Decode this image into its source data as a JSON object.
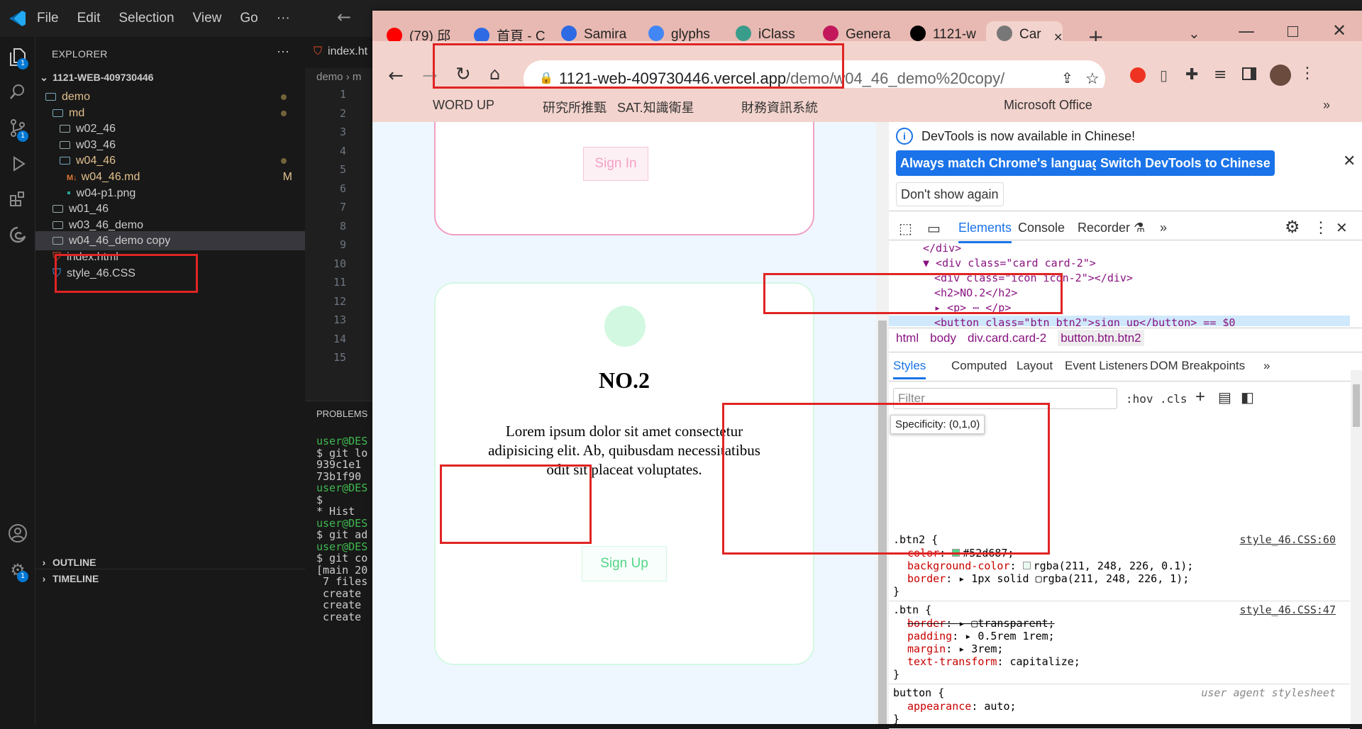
{
  "vscode": {
    "menu": [
      "File",
      "Edit",
      "Selection",
      "View",
      "Go",
      "···"
    ],
    "explorer_title": "EXPLORER",
    "explorer_more": "···",
    "project": "1121-WEB-409730446",
    "tree": [
      {
        "label": "demo",
        "indent": 1,
        "chev": "⌄",
        "type": "folder",
        "color": "#e2c08d",
        "dot": true
      },
      {
        "label": "md",
        "indent": 2,
        "chev": "⌄",
        "type": "folder",
        "color": "#e2c08d",
        "dot": true
      },
      {
        "label": "w02_46",
        "indent": 3,
        "chev": "›",
        "type": "folder",
        "color": "#ccc",
        "dot": false
      },
      {
        "label": "w03_46",
        "indent": 3,
        "chev": "›",
        "type": "folder",
        "color": "#ccc",
        "dot": false
      },
      {
        "label": "w04_46",
        "indent": 3,
        "chev": "⌄",
        "type": "folder",
        "color": "#e2c08d",
        "dot": true
      },
      {
        "label": "w04_46.md",
        "indent": 4,
        "type": "md",
        "color": "#e2c08d",
        "mark": "M"
      },
      {
        "label": "w04-p1.png",
        "indent": 4,
        "type": "img",
        "color": "#ccc"
      },
      {
        "label": "w01_46",
        "indent": 2,
        "chev": "›",
        "type": "folder",
        "color": "#ccc"
      },
      {
        "label": "w03_46_demo",
        "indent": 2,
        "chev": "›",
        "type": "folder",
        "color": "#ccc"
      },
      {
        "label": "w04_46_demo copy",
        "indent": 2,
        "chev": "›",
        "type": "folder",
        "color": "#ccc",
        "selected": true
      },
      {
        "label": "index.html",
        "indent": 2,
        "type": "html",
        "color": "#ccc"
      },
      {
        "label": "style_46.CSS",
        "indent": 2,
        "type": "css",
        "color": "#ccc"
      }
    ],
    "outline": "OUTLINE",
    "timeline": "TIMELINE",
    "editor_tab": "index.ht",
    "breadcrumb": "demo › m",
    "line_numbers": [
      "1",
      "2",
      "3",
      "4",
      "5",
      "6",
      "7",
      "8",
      "9",
      "10",
      "11",
      "12",
      "13",
      "14",
      "15"
    ],
    "panel_label": "PROBLEMS",
    "terminal": [
      "user@DES",
      "$ git lo",
      "939c1e1",
      "73b1f90",
      "",
      "user@DES",
      "$",
      "* Hist",
      "",
      "user@DES",
      "$ git ad",
      "",
      "user@DES",
      "$ git co",
      "[main 20",
      " 7 files",
      " create",
      " create",
      " create"
    ],
    "badges": {
      "explorer": "1",
      "scm": "1",
      "settings": "1"
    }
  },
  "chrome": {
    "tabs": [
      {
        "title": "(79) 邱",
        "color": "#ff0000"
      },
      {
        "title": "首頁 - C",
        "color": "#2d6ae3"
      },
      {
        "title": "Samira",
        "color": "#2d6ae3"
      },
      {
        "title": "glyphs",
        "color": "#4285f4"
      },
      {
        "title": "iClass",
        "color": "#3a9c8a"
      },
      {
        "title": "Genera",
        "color": "#c2185b"
      },
      {
        "title": "1121-w",
        "color": "#000"
      },
      {
        "title": "Car",
        "color": "#777"
      }
    ],
    "url_host": "1121-web-409730446.vercel.app",
    "url_path": "/demo/w04_46_demo%20copy/",
    "bookmarks": [
      "WORD UP",
      "研究所推甄",
      "SAT.知識衛星",
      "財務資訊系統",
      "Microsoft Office"
    ],
    "more": "»"
  },
  "page": {
    "card1_button": "Sign In",
    "card2_heading": "NO.2",
    "card2_text": "Lorem ipsum dolor sit amet consectetur adipisicing elit. Ab, quibusdam necessitatibus odit sit placeat voluptates.",
    "card2_button": "Sign Up"
  },
  "devtools": {
    "infobar": "DevTools is now available in Chinese!",
    "btn_match": "Always match Chrome's language",
    "btn_switch": "Switch DevTools to Chinese",
    "btn_dont": "Don't show again",
    "tabs": [
      "Elements",
      "Console",
      "Recorder ⚗",
      "»"
    ],
    "dom": [
      {
        "t": "</div>",
        "i": 2
      },
      {
        "t": "▼ <div class=\"card card-2\">",
        "i": 2
      },
      {
        "t": "<div class=\"icon icon-2\"></div>",
        "i": 3
      },
      {
        "t": "<h2>NO.2</h2>",
        "i": 3
      },
      {
        "t": "▸ <p> ⋯ </p>",
        "i": 3
      },
      {
        "t": "<button class=\"btn btn2\">sign up</button> == $0",
        "i": 3,
        "sel": true
      },
      {
        "t": "</div>",
        "i": 2
      }
    ],
    "crumbs": [
      "html",
      "body",
      "div.card.card-2",
      "button.btn.btn2"
    ],
    "subtabs": [
      "Styles",
      "Computed",
      "Layout",
      "Event Listeners",
      "DOM Breakpoints",
      "»"
    ],
    "filter": "Filter",
    "hov": ":hov",
    ".cls": ".cls",
    "cls": ".cls",
    "tooltip": "Specificity: (0,1,0)",
    "rule1": {
      "sel": ".btn2 {",
      "src": "style_46.CSS:60",
      "props": [
        [
          "color",
          "#52d687;",
          "#52d687"
        ],
        [
          "background-color",
          "rgba(211, 248, 226, 0.1);",
          "#e8faef"
        ],
        [
          "border",
          "▸ 1px solid ▢rgba(211, 248, 226, 1);",
          ""
        ]
      ]
    },
    "rule2": {
      "sel": ".btn {",
      "src": "style_46.CSS:47",
      "props": [
        [
          "border",
          "▸ ▢transparent;",
          "strike"
        ],
        [
          "padding",
          "▸ 0.5rem 1rem;",
          ""
        ],
        [
          "margin",
          "▸ 3rem;",
          ""
        ],
        [
          "text-transform",
          "capitalize;",
          ""
        ]
      ]
    },
    "rule3": {
      "sel": "button {",
      "src": "user agent stylesheet",
      "props": [
        [
          "appearance",
          "auto;",
          ""
        ]
      ]
    },
    "close_brace": "}"
  }
}
